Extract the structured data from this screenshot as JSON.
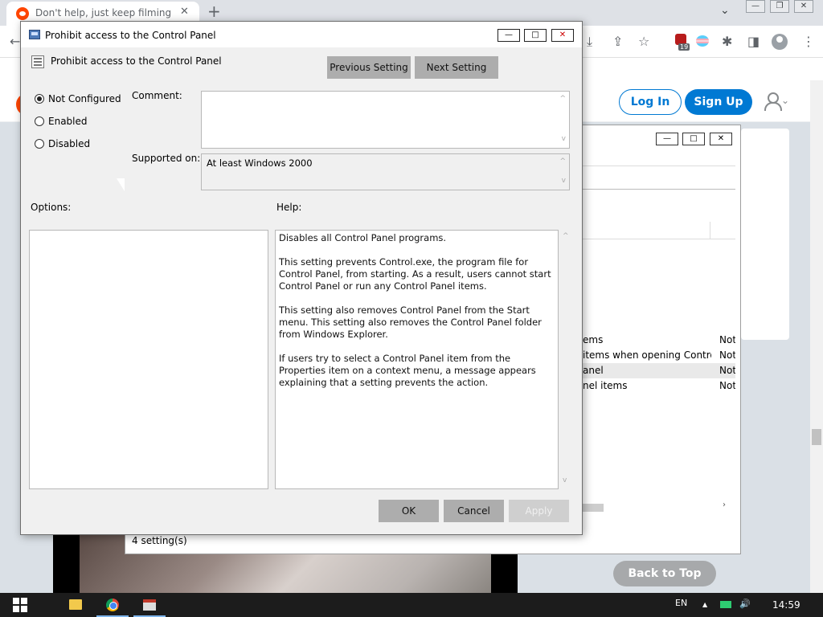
{
  "browser": {
    "tab": {
      "title": "Don't help, just keep filming",
      "close": "✕"
    },
    "new_tab": "+",
    "tab_search": "⌄",
    "window_controls": {
      "minimize": "—",
      "restore": "❐",
      "close": "✕"
    },
    "toolbar_icons": {
      "back": "←",
      "reload": "↻",
      "install": "⤓",
      "share": "⇪",
      "bookmark": "☆",
      "extensions": "✱",
      "sidepanel": "◨",
      "menu": "⋮"
    },
    "extension_badge_count": "19"
  },
  "reddit": {
    "login_label": "Log In",
    "signup_label": "Sign Up",
    "user_chevron": "⌄",
    "back_to_top_label": "Back to Top"
  },
  "gpo_window": {
    "controls": {
      "minimize": "—",
      "restore": "□",
      "close": "✕"
    },
    "rows": [
      {
        "name": "ems",
        "state": "Not"
      },
      {
        "name": "items when opening Control ...",
        "state": "Not"
      },
      {
        "name": "anel",
        "state": "Not"
      },
      {
        "name": "nel items",
        "state": "Not"
      }
    ],
    "scroll_right": "›",
    "status_text": "4 setting(s)"
  },
  "dialog": {
    "title": "Prohibit access to the Control Panel",
    "controls": {
      "minimize": "—",
      "restore": "□",
      "close": "✕"
    },
    "policy_name": "Prohibit access to the Control Panel",
    "previous_setting_label": "Previous Setting",
    "next_setting_label": "Next Setting",
    "radio_options": [
      {
        "label": "Not Configured",
        "selected": true
      },
      {
        "label": "Enabled",
        "selected": false
      },
      {
        "label": "Disabled",
        "selected": false
      }
    ],
    "comment_label": "Comment:",
    "comment_value": "",
    "supported_on_label": "Supported on:",
    "supported_on_value": "At least Windows 2000",
    "options_label": "Options:",
    "help_label": "Help:",
    "help_paragraphs": [
      "Disables all Control Panel programs.",
      "This setting prevents Control.exe, the program file for Control Panel, from starting. As a result, users cannot start Control Panel or run any Control Panel items.",
      "This setting also removes Control Panel from the Start menu. This setting also removes the Control Panel folder from Windows Explorer.",
      "If users try to select a Control Panel item from the Properties item on a context menu, a message appears explaining that a setting prevents the action."
    ],
    "scroll_up": "^",
    "scroll_down": "v",
    "ok_label": "OK",
    "cancel_label": "Cancel",
    "apply_label": "Apply"
  },
  "taskbar": {
    "language": "EN",
    "tray_up_arrow": "▲",
    "volume_icon": "🔊",
    "time": "14:59"
  }
}
